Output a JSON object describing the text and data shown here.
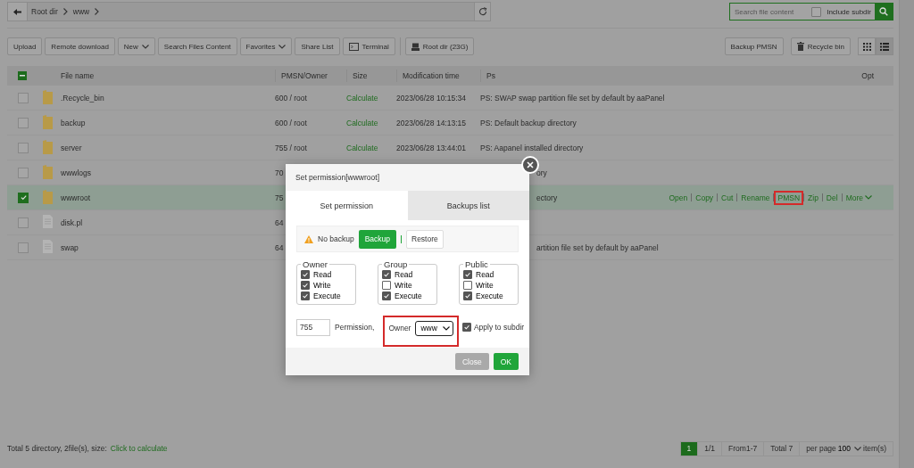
{
  "path_bar": {
    "crumbs": [
      "Root dir",
      "www"
    ]
  },
  "search": {
    "placeholder": "Search file content",
    "include_subdir": {
      "label": "Include subdir",
      "checked": false
    }
  },
  "toolbar": {
    "left": [
      {
        "label": "Upload",
        "kind": "plain"
      },
      {
        "label": "Remote download",
        "kind": "plain"
      },
      {
        "label": "New",
        "kind": "dropdown"
      },
      {
        "label": "Search Files Content",
        "kind": "plain"
      },
      {
        "label": "Favorites",
        "kind": "dropdown"
      },
      {
        "label": "Share List",
        "kind": "plain"
      },
      {
        "label": "Terminal",
        "kind": "terminal"
      },
      {
        "label": "Root dir (23G)",
        "kind": "disk"
      }
    ],
    "right": [
      {
        "label": "Backup PMSN",
        "kind": "plain"
      },
      {
        "label": "Recycle bin",
        "kind": "trash"
      }
    ],
    "view_modes": [
      {
        "kind": "grid",
        "selected": false
      },
      {
        "kind": "list",
        "selected": true
      }
    ]
  },
  "table": {
    "partial_selection": true,
    "columns": [
      "File name",
      "PMSN/Owner",
      "Size",
      "Modification time",
      "Ps",
      "Opt"
    ],
    "rows": [
      {
        "name": ".Recycle_bin",
        "kind": "folder",
        "checked": false,
        "pmsn": "600 / root",
        "size": "Calculate",
        "time": "2023/06/28 10:15:34",
        "ps": "PS: SWAP swap partition file set by default by aaPanel",
        "ps_cut": false
      },
      {
        "name": "backup",
        "kind": "folder",
        "checked": false,
        "pmsn": "600 / root",
        "size": "Calculate",
        "time": "2023/06/28 14:13:15",
        "ps": "PS: Default backup directory",
        "ps_cut": false
      },
      {
        "name": "server",
        "kind": "folder",
        "checked": false,
        "pmsn": "755 / root",
        "size": "Calculate",
        "time": "2023/06/28 13:44:01",
        "ps": "PS: Aapanel installed directory",
        "ps_cut": false
      },
      {
        "name": "wwwlogs",
        "kind": "folder",
        "checked": false,
        "pmsn": "70",
        "ps": "ory",
        "ps_cut": true
      },
      {
        "name": "wwwroot",
        "kind": "folder",
        "checked": true,
        "pmsn": "75",
        "ps": "ectory",
        "ps_cut": true,
        "actions": [
          {
            "label": "Open",
            "kind": "link",
            "highlighted": false
          },
          {
            "label": "Copy",
            "kind": "link",
            "highlighted": false
          },
          {
            "label": "Cut",
            "kind": "link",
            "highlighted": false
          },
          {
            "label": "Rename",
            "kind": "link",
            "highlighted": false
          },
          {
            "label": "PMSN",
            "kind": "link",
            "highlighted": true
          },
          {
            "label": "Zip",
            "kind": "link",
            "highlighted": false
          },
          {
            "label": "Del",
            "kind": "link",
            "highlighted": false
          },
          {
            "label": "More",
            "kind": "dropdown",
            "highlighted": false
          }
        ]
      },
      {
        "name": "disk.pl",
        "kind": "file",
        "checked": false,
        "pmsn": "64"
      },
      {
        "name": "swap",
        "kind": "file",
        "checked": false,
        "pmsn": "64",
        "ps": "artition file set by default by aaPanel",
        "ps_cut": true
      }
    ]
  },
  "status_bar": {
    "summary": "Total 5 directory, 2file(s), size:",
    "link": "Click to calculate"
  },
  "pagination": {
    "pages": [
      {
        "label": "1",
        "selected": true
      }
    ],
    "page_info": "1/1",
    "range": "From1-7",
    "total": "Total 7",
    "per_page_label": "per page",
    "per_page": "100",
    "unit": "item(s)"
  },
  "dialog": {
    "title": "Set permission[wwwroot]",
    "tabs": [
      {
        "label": "Set permission",
        "selected": true
      },
      {
        "label": "Backups list",
        "selected": false
      }
    ],
    "backup_status": "No backup",
    "backup_button": "Backup",
    "restore_button": "Restore",
    "groups": [
      {
        "title": "Owner",
        "perms": [
          {
            "label": "Read",
            "checked": true
          },
          {
            "label": "Write",
            "checked": true
          },
          {
            "label": "Execute",
            "checked": true
          }
        ]
      },
      {
        "title": "Group",
        "perms": [
          {
            "label": "Read",
            "checked": true
          },
          {
            "label": "Write",
            "checked": false
          },
          {
            "label": "Execute",
            "checked": true
          }
        ]
      },
      {
        "title": "Public",
        "perms": [
          {
            "label": "Read",
            "checked": true
          },
          {
            "label": "Write",
            "checked": false
          },
          {
            "label": "Execute",
            "checked": true
          }
        ]
      }
    ],
    "permission_value": "755",
    "permission_label": "Permission,",
    "owner_label": "Owner",
    "owner_value": "www",
    "owner_highlighted": true,
    "apply_subdir": {
      "label": "Apply to subdir",
      "checked": true
    },
    "buttons": [
      {
        "label": "Close",
        "disabled": true
      },
      {
        "label": "OK",
        "disabled": false
      }
    ]
  }
}
